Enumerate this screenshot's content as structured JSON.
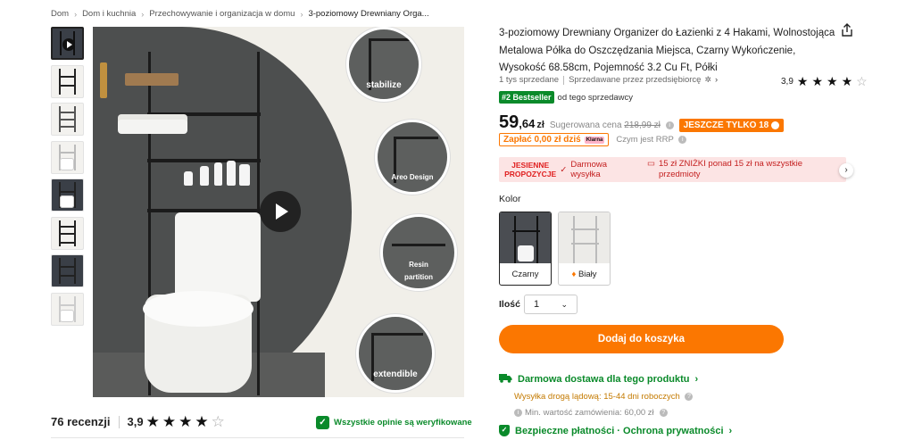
{
  "breadcrumb": [
    "Dom",
    "Dom i kuchnia",
    "Przechowywanie i organizacja w domu",
    "3-poziomowy Drewniany Orga..."
  ],
  "image_captions": [
    "stabilize",
    "Areo Design",
    "Resin",
    "partition",
    "extendible"
  ],
  "reviews": {
    "count": "76 recenzji",
    "score": "3,9",
    "stars_filled": 4,
    "verified": "Wszystkie opinie są weryfikowane"
  },
  "product": {
    "title": "3-poziomowy Drewniany Organizer do Łazienki z 4 Hakami, Wolnostojąca Metalowa Półka do Oszczędzania Miejsca, Czarny Wykończenie, Wysokość 68.58cm, Pojemność 3.2 Cu Ft, Półki",
    "sold": "1 tys sprzedane",
    "seller": "Sprzedawane przez przedsiębiorcę",
    "rating": "3,9",
    "bestseller_tag": "#2 Bestseller",
    "bestseller_text": "od tego sprzedawcy"
  },
  "price": {
    "main": "59",
    "decimals": ",64",
    "currency": "zł",
    "rrp_label": "Sugerowana cena",
    "rrp_value": "218,99 zł",
    "only_badge": "JESZCZE TYLKO 18",
    "pay_today": "Zapłać 0,00 zł dziś",
    "klarna": "Klarna",
    "what_rrp": "Czym jest RRP"
  },
  "promo": {
    "season_line1": "JESIENNE",
    "season_line2": "PROPOZYCJE",
    "free_shipping": "Darmowa wysyłka",
    "discount": "15 zł ZNIŻKI ponad 15 zł na wszystkie przedmioty"
  },
  "color": {
    "label": "Kolor",
    "options": [
      {
        "name": "Czarny",
        "selected": true
      },
      {
        "name": "Biały",
        "selected": false
      }
    ]
  },
  "quantity": {
    "label": "Ilość",
    "value": "1"
  },
  "add_to_cart": "Dodaj do koszyka",
  "shipping": {
    "title": "Darmowa dostawa dla tego produktu",
    "land": "Wysyłka drogą lądową: 15-44 dni roboczych",
    "min_order": "Min. wartość zamówienia: 60,00 zł"
  },
  "secure": "Bezpieczne płatności · Ochrona prywatności",
  "colors": {
    "accent": "#fb7701",
    "green": "#0a8a2a",
    "promo_bg": "#fce4e4",
    "promo_red": "#e02020"
  }
}
